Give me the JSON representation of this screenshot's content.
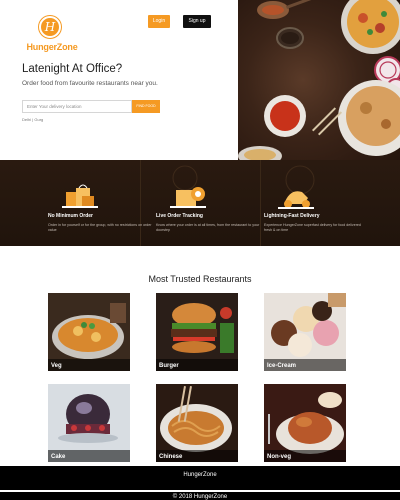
{
  "brand": {
    "name": "HungerZone",
    "logo_letter": "H"
  },
  "header": {
    "login_label": "Login",
    "signup_label": "Sign up"
  },
  "hero": {
    "headline": "Latenight At Office?",
    "subline": "Order food from favourite restaurants near you.",
    "location_placeholder": "Enter Your delivery location",
    "find_label": "FIND FOOD",
    "popular_cities": "Delhi | Gurg"
  },
  "features": [
    {
      "title": "No Minimum Order",
      "desc": "Order in for yourself or for the group, with no restrictions on order value"
    },
    {
      "title": "Live Order Tracking",
      "desc": "Know where your order is at all times, from the restaurant to your doorstep"
    },
    {
      "title": "Lightning-Fast Delivery",
      "desc": "Experience HungerZone superfast delivery for food delivered fresh & on time"
    }
  ],
  "trusted": {
    "title": "Most Trusted Restaurants",
    "items": [
      {
        "label": "Veg"
      },
      {
        "label": "Burger"
      },
      {
        "label": "Ice-Cream"
      },
      {
        "label": "Cake"
      },
      {
        "label": "Chinese"
      },
      {
        "label": "Non-veg"
      }
    ]
  },
  "footer": {
    "name": "HungerZone",
    "copyright": "© 2018 HungerZone"
  },
  "colors": {
    "accent": "#f59a23",
    "dark_band": "#20140c",
    "footer": "#000000"
  }
}
